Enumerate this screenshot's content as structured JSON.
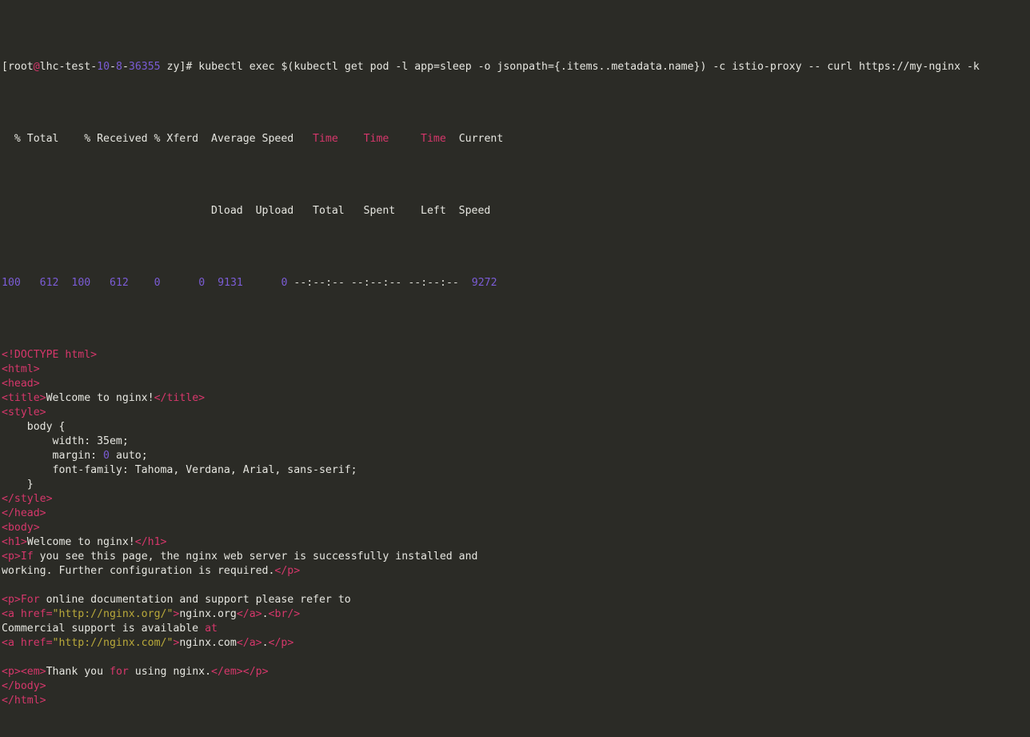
{
  "terminal": {
    "title": "terminal-session",
    "background_color": "#2b2b26",
    "foreground_color": "#d9d9d3",
    "colors": {
      "tag": "#d6376b",
      "number": "#7b5cd6",
      "string": "#b9a93a",
      "plain": "#e6e6e0"
    },
    "font_size_px": 13.2,
    "line_height_px": 18,
    "cols": 166,
    "rows": 29
  },
  "prompt": {
    "bracket_open": "[",
    "user": "root",
    "at": "@",
    "host_part1": "lhc-test-",
    "host_num1": "10",
    "host_dash1": "-",
    "host_num2": "8",
    "host_dash2": "-",
    "host_num3": "36355",
    "space_cwd": " zy",
    "bracket_close": "]",
    "sigil": "#",
    "command": " kubectl exec $(kubectl get pod -l app=sleep -o jsonpath={.items..metadata.name}) -c istio-proxy -- curl https://my-nginx -k"
  },
  "curl_progress": {
    "header_row1": {
      "pre_total": "  % Total    % Received % Xferd  Average Speed   ",
      "time1": "Time",
      "gap1": "    ",
      "time2": "Time",
      "gap2": "     ",
      "time3": "Time",
      "gap3": "  ",
      "current": "Current"
    },
    "header_row2": "                                 Dload  Upload   Total   Spent    Left  Speed",
    "data_row": {
      "percent_total": "100",
      "total": "612",
      "percent_received": "100",
      "received": "612",
      "percent_xferd": "0",
      "xferd": "0",
      "avg_dload": "9131",
      "avg_upload": "0",
      "time_total": "--:--:--",
      "time_spent": "--:--:--",
      "time_left": "--:--:--",
      "current_speed": "9272"
    }
  },
  "html_output": {
    "lines": [
      {
        "id": "doctype",
        "tokens": [
          {
            "t": "<!DOCTYPE html>",
            "c": "tag"
          }
        ]
      },
      {
        "id": "html-open",
        "tokens": [
          {
            "t": "<html>",
            "c": "tag"
          }
        ]
      },
      {
        "id": "head-open",
        "tokens": [
          {
            "t": "<head>",
            "c": "tag"
          }
        ]
      },
      {
        "id": "title",
        "tokens": [
          {
            "t": "<title>",
            "c": "tag"
          },
          {
            "t": "Welcome to nginx!",
            "c": "plain"
          },
          {
            "t": "</title>",
            "c": "tag"
          }
        ]
      },
      {
        "id": "style-open",
        "tokens": [
          {
            "t": "<style>",
            "c": "tag"
          }
        ]
      },
      {
        "id": "css-body",
        "tokens": [
          {
            "t": "    body {",
            "c": "plain"
          }
        ]
      },
      {
        "id": "css-width",
        "tokens": [
          {
            "t": "        width: 35em;",
            "c": "plain"
          }
        ]
      },
      {
        "id": "css-margin",
        "tokens": [
          {
            "t": "        margin: ",
            "c": "plain"
          },
          {
            "t": "0",
            "c": "number"
          },
          {
            "t": " auto;",
            "c": "plain"
          }
        ]
      },
      {
        "id": "css-font",
        "tokens": [
          {
            "t": "        font-family: Tahoma, Verdana, Arial, sans-serif;",
            "c": "plain"
          }
        ]
      },
      {
        "id": "css-close",
        "tokens": [
          {
            "t": "    }",
            "c": "plain"
          }
        ]
      },
      {
        "id": "style-close",
        "tokens": [
          {
            "t": "</style>",
            "c": "tag"
          }
        ]
      },
      {
        "id": "head-close",
        "tokens": [
          {
            "t": "</head>",
            "c": "tag"
          }
        ]
      },
      {
        "id": "body-open",
        "tokens": [
          {
            "t": "<body>",
            "c": "tag"
          }
        ]
      },
      {
        "id": "h1",
        "tokens": [
          {
            "t": "<h1>",
            "c": "tag"
          },
          {
            "t": "Welcome to nginx!",
            "c": "plain"
          },
          {
            "t": "</h1>",
            "c": "tag"
          }
        ]
      },
      {
        "id": "p1-line1",
        "tokens": [
          {
            "t": "<p>",
            "c": "tag"
          },
          {
            "t": "If",
            "c": "tag"
          },
          {
            "t": " you see this page, the nginx web server is successfully installed and",
            "c": "plain"
          }
        ]
      },
      {
        "id": "p1-line2",
        "tokens": [
          {
            "t": "working. Further configuration is required.",
            "c": "plain"
          },
          {
            "t": "</p>",
            "c": "tag"
          }
        ]
      },
      {
        "id": "blank-1",
        "tokens": [
          {
            "t": "",
            "c": "plain"
          }
        ]
      },
      {
        "id": "p2-line1",
        "tokens": [
          {
            "t": "<p>",
            "c": "tag"
          },
          {
            "t": "For",
            "c": "tag"
          },
          {
            "t": " online documentation and support please refer to",
            "c": "plain"
          }
        ]
      },
      {
        "id": "p2-line2",
        "tokens": [
          {
            "t": "<a href=",
            "c": "tag"
          },
          {
            "t": "\"http://nginx.org/\"",
            "c": "string"
          },
          {
            "t": ">",
            "c": "tag"
          },
          {
            "t": "nginx.org",
            "c": "plain"
          },
          {
            "t": "</a>",
            "c": "tag"
          },
          {
            "t": ".",
            "c": "plain"
          },
          {
            "t": "<br/>",
            "c": "tag"
          }
        ]
      },
      {
        "id": "p2-line3",
        "tokens": [
          {
            "t": "Commercial support is available ",
            "c": "plain"
          },
          {
            "t": "at",
            "c": "tag"
          }
        ]
      },
      {
        "id": "p2-line4",
        "tokens": [
          {
            "t": "<a href=",
            "c": "tag"
          },
          {
            "t": "\"http://nginx.com/\"",
            "c": "string"
          },
          {
            "t": ">",
            "c": "tag"
          },
          {
            "t": "nginx.com",
            "c": "plain"
          },
          {
            "t": "</a>",
            "c": "tag"
          },
          {
            "t": ".",
            "c": "plain"
          },
          {
            "t": "</p>",
            "c": "tag"
          }
        ]
      },
      {
        "id": "blank-2",
        "tokens": [
          {
            "t": "",
            "c": "plain"
          }
        ]
      },
      {
        "id": "p3",
        "tokens": [
          {
            "t": "<p>",
            "c": "tag"
          },
          {
            "t": "<em>",
            "c": "tag"
          },
          {
            "t": "Thank you ",
            "c": "plain"
          },
          {
            "t": "for",
            "c": "tag"
          },
          {
            "t": " using nginx.",
            "c": "plain"
          },
          {
            "t": "</em>",
            "c": "tag"
          },
          {
            "t": "</p>",
            "c": "tag"
          }
        ]
      },
      {
        "id": "body-close",
        "tokens": [
          {
            "t": "</body>",
            "c": "tag"
          }
        ]
      },
      {
        "id": "html-close",
        "tokens": [
          {
            "t": "</html>",
            "c": "tag"
          }
        ]
      }
    ]
  }
}
